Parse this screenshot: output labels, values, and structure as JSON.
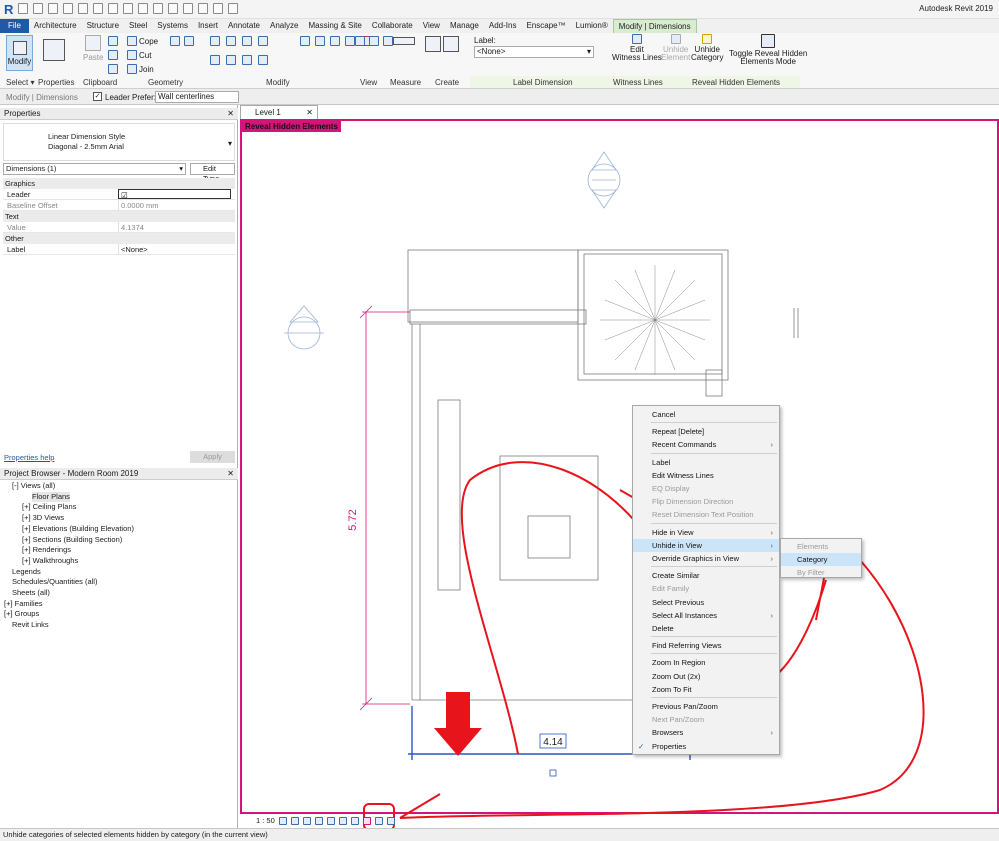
{
  "app": {
    "title": "Autodesk Revit 2019"
  },
  "ribbon": {
    "tabs": [
      "File",
      "Architecture",
      "Structure",
      "Steel",
      "Systems",
      "Insert",
      "Annotate",
      "Analyze",
      "Massing & Site",
      "Collaborate",
      "View",
      "Manage",
      "Add-Ins",
      "Enscape™",
      "Lumion®",
      "Modify | Dimensions"
    ],
    "active_tab": "Modify | Dimensions",
    "modify_label": "Modify",
    "paste_label": "Paste",
    "cope_label": "Cope",
    "cut_label": "Cut",
    "join_label": "Join",
    "label_field_caption": "Label:",
    "label_value": "<None>",
    "edit_witness_label": "Edit\nWitness Lines",
    "unhide_element_label": "Unhide\nElement",
    "unhide_category_label": "Unhide\nCategory",
    "toggle_reveal_label": "Toggle Reveal Hidden\nElements Mode",
    "panels": {
      "select": "Select",
      "properties": "Properties",
      "clipboard": "Clipboard",
      "geometry": "Geometry",
      "modify": "Modify",
      "view": "View",
      "measure": "Measure",
      "create": "Create",
      "label_dimension": "Label Dimension",
      "witness_lines": "Witness Lines",
      "reveal_hidden": "Reveal Hidden Elements"
    }
  },
  "options_bar": {
    "context": "Modify | Dimensions",
    "leader_label": "Leader",
    "prefer_label": "Prefer:",
    "prefer_value": "Wall centerlines"
  },
  "properties": {
    "header": "Properties",
    "type_line1": "Linear Dimension Style",
    "type_line2": "Diagonal - 2.5mm Arial",
    "selector": "Dimensions (1)",
    "edit_type": "Edit Type",
    "groups": {
      "graphics": "Graphics",
      "text": "Text",
      "other": "Other"
    },
    "rows": {
      "leader": "Leader",
      "baseline_offset": "Baseline Offset",
      "baseline_offset_value": "0.0000 mm",
      "value": "Value",
      "value_value": "4.1374",
      "label": "Label",
      "label_value": "<None>"
    },
    "help": "Properties help",
    "apply": "Apply"
  },
  "browser": {
    "header": "Project Browser - Modern Room 2019",
    "items": [
      "Views (all)",
      "Floor Plans",
      "Ceiling Plans",
      "3D Views",
      "Elevations (Building Elevation)",
      "Sections (Building Section)",
      "Renderings",
      "Walkthroughs",
      "Legends",
      "Schedules/Quantities (all)",
      "Sheets (all)",
      "Families",
      "Groups",
      "Revit Links"
    ]
  },
  "view": {
    "tab": "Level 1",
    "mode_label": "Reveal Hidden Elements",
    "dim_vertical": "5.72",
    "dim_horizontal": "4.14",
    "scale": "1 : 50"
  },
  "context_menu": {
    "items": [
      "Cancel",
      "Repeat [Delete]",
      "Recent Commands",
      "Label",
      "Edit Witness Lines",
      "EQ Display",
      "Flip Dimension Direction",
      "Reset Dimension Text Position",
      "Hide in View",
      "Unhide in View",
      "Override Graphics in View",
      "Create Similar",
      "Edit Family",
      "Select Previous",
      "Select All Instances",
      "Delete",
      "Find Referring Views",
      "Zoom In Region",
      "Zoom Out (2x)",
      "Zoom To Fit",
      "Previous Pan/Zoom",
      "Next Pan/Zoom",
      "Browsers",
      "Properties"
    ],
    "submenu": [
      "Elements",
      "Category",
      "By Filter"
    ]
  },
  "status": {
    "text": "Unhide categories of selected elements hidden by category (in the current view)"
  },
  "colors": {
    "reveal": "#d4147a",
    "annotation": "#e8141c",
    "dimension": "#2a56c6",
    "ribbon_file": "#1f5aa6"
  }
}
